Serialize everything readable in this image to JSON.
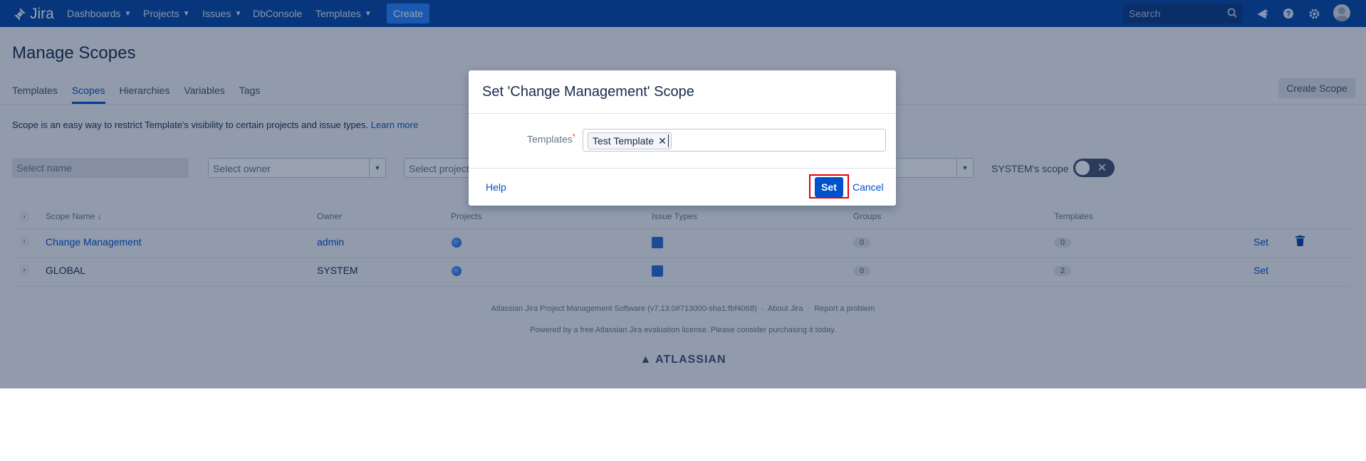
{
  "topnav": {
    "logo_text": "Jira",
    "items": [
      {
        "label": "Dashboards",
        "has_menu": true
      },
      {
        "label": "Projects",
        "has_menu": true
      },
      {
        "label": "Issues",
        "has_menu": true
      },
      {
        "label": "DbConsole",
        "has_menu": false
      },
      {
        "label": "Templates",
        "has_menu": true
      }
    ],
    "create_label": "Create",
    "search_placeholder": "Search",
    "icons": [
      "search-icon",
      "notifications-icon",
      "help-icon",
      "settings-icon",
      "avatar"
    ]
  },
  "page": {
    "title": "Manage Scopes",
    "tabs": [
      {
        "label": "Templates",
        "active": false
      },
      {
        "label": "Scopes",
        "active": true
      },
      {
        "label": "Hierarchies",
        "active": false
      },
      {
        "label": "Variables",
        "active": false
      },
      {
        "label": "Tags",
        "active": false
      }
    ],
    "create_scope_label": "Create Scope",
    "description": "Scope is an easy way to restrict Template's visibility to certain projects and issue types.",
    "learn_more": "Learn more"
  },
  "filters": {
    "name_placeholder": "Select name",
    "owner_placeholder": "Select owner",
    "project_placeholder": "Select project",
    "system_scope_label": "SYSTEM's scope",
    "system_scope_on": false
  },
  "table": {
    "headers": {
      "scope_name": "Scope Name",
      "owner": "Owner",
      "projects": "Projects",
      "issue_types": "Issue Types",
      "groups": "Groups",
      "templates": "Templates"
    },
    "rows": [
      {
        "scope_name": "Change Management",
        "owner": "admin",
        "groups": "0",
        "templates": "0",
        "action": "Set",
        "deletable": true
      },
      {
        "scope_name": "GLOBAL",
        "owner": "SYSTEM",
        "groups": "0",
        "templates": "2",
        "action": "Set",
        "deletable": false
      }
    ]
  },
  "footer": {
    "line1": "Atlassian Jira Project Management Software (v7.13.0#713000-sha1:fbf4068)",
    "about": "About Jira",
    "report": "Report a problem",
    "line2": "Powered by a free Atlassian Jira evaluation license. Please consider purchasing it today.",
    "brand": "ATLASSIAN"
  },
  "modal": {
    "title": "Set 'Change Management' Scope",
    "field_label": "Templates",
    "required_mark": "*",
    "selected_chips": [
      "Test Template"
    ],
    "help_label": "Help",
    "set_label": "Set",
    "cancel_label": "Cancel"
  },
  "colors": {
    "nav": "#0747a6",
    "primary": "#0052cc",
    "highlight": "#e3000f"
  }
}
